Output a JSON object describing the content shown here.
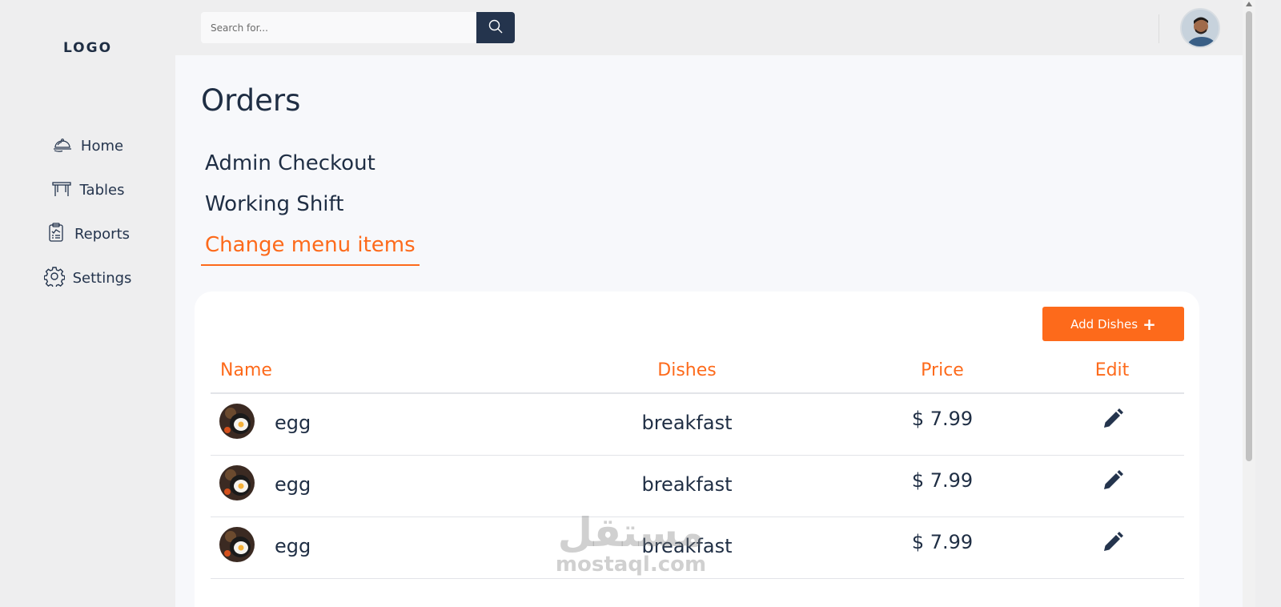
{
  "sidebar": {
    "logo": "LOGO",
    "items": [
      {
        "label": "Home",
        "icon": "cloche-icon"
      },
      {
        "label": "Tables",
        "icon": "table-icon"
      },
      {
        "label": "Reports",
        "icon": "clipboard-icon"
      },
      {
        "label": "Settings",
        "icon": "gear-icon"
      }
    ]
  },
  "header": {
    "search_placeholder": "Search for...",
    "search_icon": "search-icon"
  },
  "main": {
    "title": "Orders",
    "links": [
      {
        "label": "Admin Checkout",
        "active": false
      },
      {
        "label": "Working Shift",
        "active": false
      },
      {
        "label": "Change menu items",
        "active": true
      }
    ],
    "add_button": {
      "label": "Add Dishes",
      "icon": "plus-icon"
    },
    "table": {
      "columns": [
        "Name",
        "Dishes",
        "Price",
        "Edit"
      ],
      "rows": [
        {
          "name": "egg",
          "dish": "breakfast",
          "price": "$ 7.99",
          "edit_icon": "pencil-icon"
        },
        {
          "name": "egg",
          "dish": "breakfast",
          "price": "$ 7.99",
          "edit_icon": "pencil-icon"
        },
        {
          "name": "egg",
          "dish": "breakfast",
          "price": "$ 7.99",
          "edit_icon": "pencil-icon"
        }
      ]
    }
  },
  "watermark": {
    "arabic": "مستقل",
    "latin": "mostaql.com"
  },
  "colors": {
    "accent": "#fd6a1b",
    "primary": "#1f2e44",
    "background": "#eeeeef",
    "main_bg": "#f7f8fb"
  }
}
